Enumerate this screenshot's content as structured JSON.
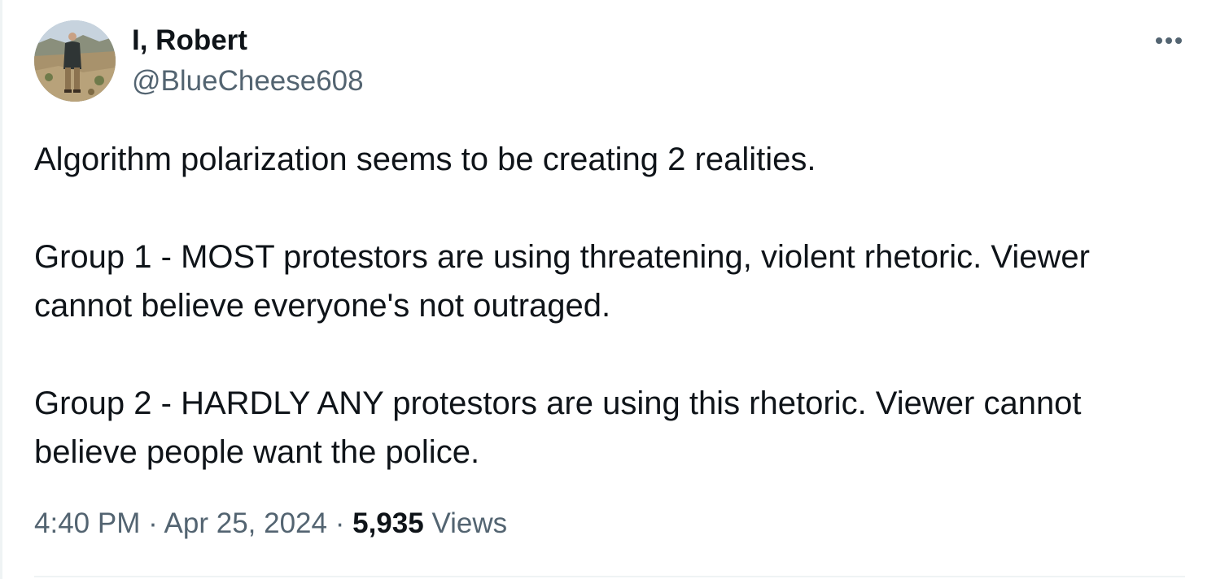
{
  "author": {
    "display_name": "I, Robert",
    "handle": "@BlueCheese608",
    "avatar_icon": "profile-photo"
  },
  "menu": {
    "icon": "more-horizontal-icon"
  },
  "tweet": {
    "lines": [
      "Algorithm polarization seems to be creating 2 realities.",
      "Group 1 - MOST protestors are using threatening, violent rhetoric. Viewer",
      "cannot believe everyone's not outraged.",
      "Group 2 - HARDLY ANY protestors are using this rhetoric. Viewer cannot",
      "believe people want the police."
    ]
  },
  "meta": {
    "time": "4:40 PM",
    "separator": "·",
    "date": "Apr 25, 2024",
    "views_count": "5,935",
    "views_label": "Views"
  },
  "colors": {
    "text_primary": "#0f1419",
    "text_secondary": "#536471",
    "divider": "#eff3f4"
  }
}
